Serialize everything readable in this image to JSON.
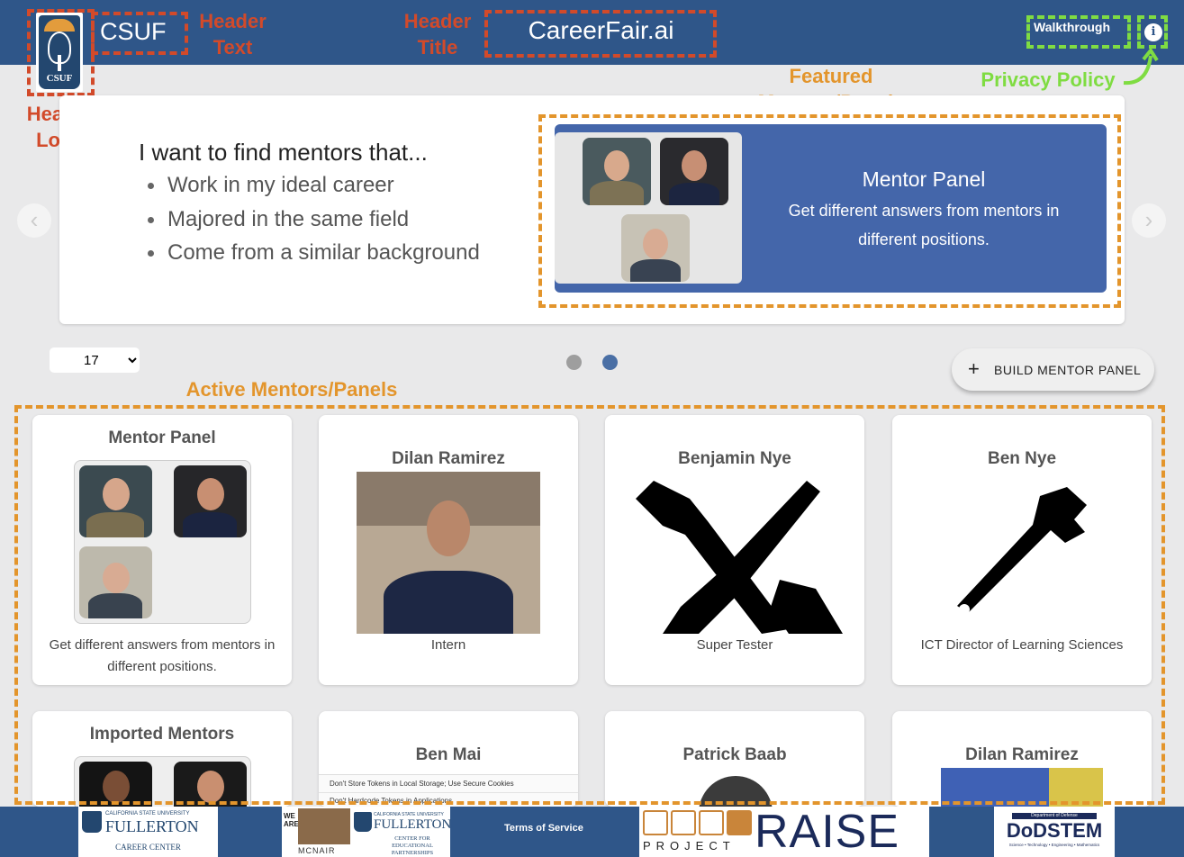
{
  "header": {
    "logo_text": "CSUF",
    "header_text": "CSUF",
    "title": "CareerFair.ai",
    "walkthrough_label": "Walkthrough",
    "info_glyph": "i"
  },
  "annotations": {
    "header_logo": "Header Logo",
    "header_text": "Header Text",
    "header_title": "Header Title",
    "featured": "Featured Mentors/Panels",
    "privacy": "Privacy Policy",
    "active": "Active Mentors/Panels"
  },
  "carousel": {
    "lead": "I want to find mentors that...",
    "bullets": [
      "Work in my ideal career",
      "Majored in the same field",
      "Come from a similar background"
    ],
    "featured_title": "Mentor Panel",
    "featured_desc": "Get different answers from mentors in different positions.",
    "prev_icon": "chevron-left-icon",
    "next_icon": "chevron-right-icon",
    "active_slide": 2,
    "slide_count": 2
  },
  "controls": {
    "count_value": "17",
    "build_label": "BUILD MENTOR PANEL",
    "build_icon": "plus-icon"
  },
  "cards": [
    {
      "name": "Mentor Panel",
      "role": "Get different answers from mentors in different positions."
    },
    {
      "name": "Dilan Ramirez",
      "role": "Intern"
    },
    {
      "name": "Benjamin Nye",
      "role": "Super Tester"
    },
    {
      "name": "Ben Nye",
      "role": "ICT Director of Learning Sciences"
    },
    {
      "name": "Imported Mentors",
      "role": ""
    },
    {
      "name": "Ben Mai",
      "role": "",
      "screenshot_lines": [
        "Don't Store Tokens in Local Storage; Use Secure Cookies",
        "Don't Hardcode Tokens in Applications"
      ]
    },
    {
      "name": "Patrick Baab",
      "role": ""
    },
    {
      "name": "Dilan Ramirez",
      "role": ""
    }
  ],
  "footer": {
    "terms": "Terms of Service",
    "logo1": {
      "top": "CALIFORNIA STATE UNIVERSITY",
      "main": "FULLERTON",
      "sub": "CAREER CENTER"
    },
    "logo2": {
      "side": "WE ARE",
      "name": "MCNAIR",
      "top": "CALIFORNIA STATE UNIVERSITY",
      "main": "FULLERTON",
      "sub": "CENTER FOR EDUCATIONAL PARTNERSHIPS"
    },
    "logo3": {
      "sub": "PROJECT",
      "main": "RAISE"
    },
    "logo4": {
      "top": "Department of Defense",
      "main": "DoDSTEM",
      "sub": "Science • Technology • Engineering • Mathematics"
    }
  },
  "colors": {
    "header_bg": "#2f5689",
    "accent_blue": "#4466aa",
    "annotation_red": "#d24a2a",
    "annotation_orange": "#e3952c",
    "annotation_green": "#7fdc42"
  }
}
